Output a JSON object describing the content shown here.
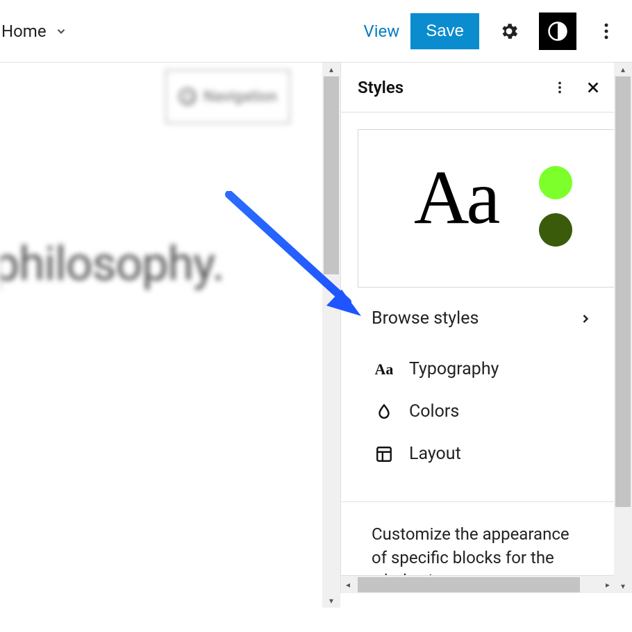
{
  "topbar": {
    "home": "Home",
    "view": "View",
    "save": "Save"
  },
  "canvas": {
    "navigation_label": "Navigation",
    "heading_text": "philosophy."
  },
  "styles_panel": {
    "title": "Styles",
    "preview_text": "Aa",
    "swatches": {
      "primary": "#7cff2a",
      "secondary": "#3a5c0a"
    },
    "browse_label": "Browse styles",
    "sections": {
      "typography": "Typography",
      "colors": "Colors",
      "layout": "Layout"
    },
    "description": "Customize the appearance of specific blocks for the whole site."
  }
}
